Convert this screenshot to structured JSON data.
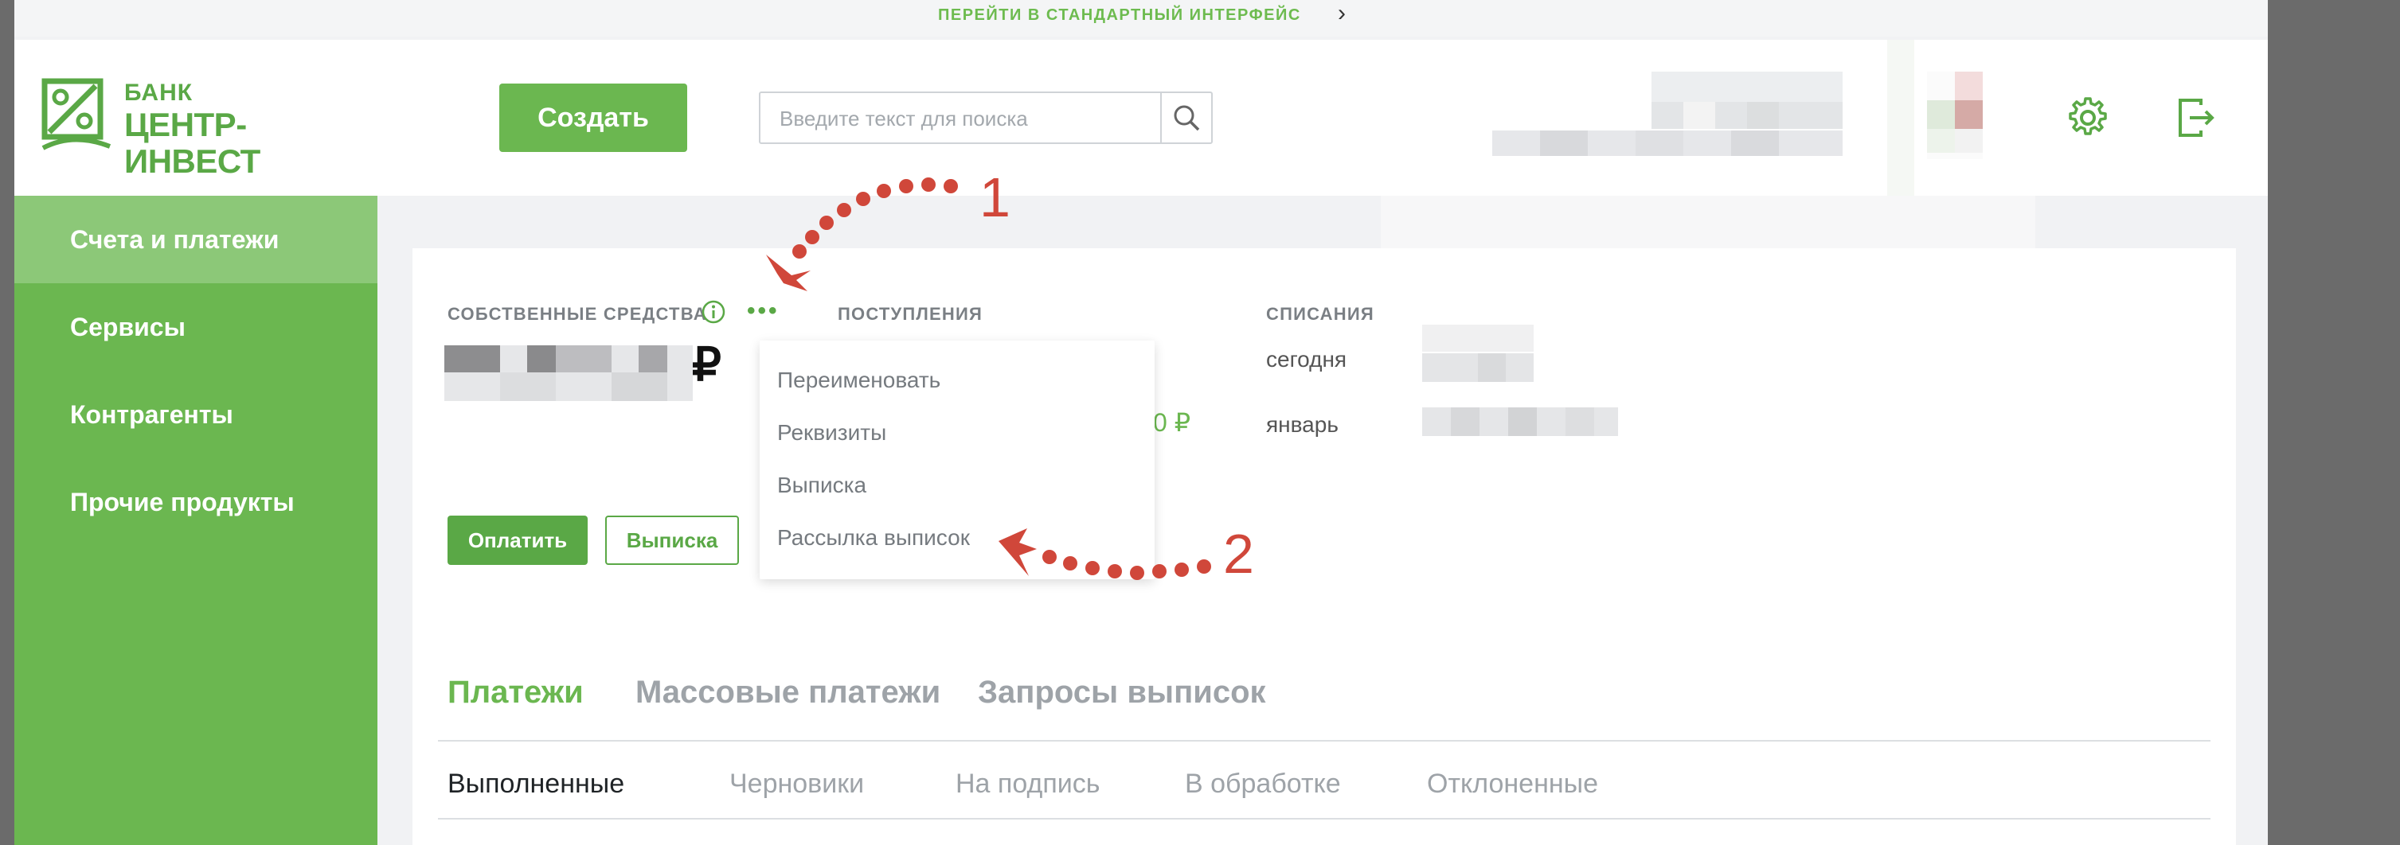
{
  "top_link": {
    "label": "ПЕРЕЙТИ В СТАНДАРТНЫЙ ИНТЕРФЕЙС"
  },
  "header": {
    "logo_line1": "БАНК",
    "logo_line2": "ЦЕНТР-ИНВЕСТ",
    "create_label": "Создать",
    "search_placeholder": "Введите текст для поиска"
  },
  "sidebar": {
    "items": [
      {
        "label": "Счета и платежи",
        "active": true
      },
      {
        "label": "Сервисы"
      },
      {
        "label": "Контрагенты"
      },
      {
        "label": "Прочие продукты"
      }
    ]
  },
  "account": {
    "own_funds_label": "СОБСТВЕННЫЕ СРЕДСТВА",
    "more_dots": "•••",
    "income_label": "ПОСТУПЛЕНИЯ",
    "debit_label": "СПИСАНИЯ",
    "currency": "₽",
    "today_label": "сегодня",
    "month_label": "январь",
    "income_value": "0 ₽",
    "pay_label": "Оплатить",
    "statement_label": "Выписка"
  },
  "menu": {
    "items": [
      "Переименовать",
      "Реквизиты",
      "Выписка",
      "Рассылка выписок"
    ]
  },
  "tabs": [
    "Платежи",
    "Массовые платежи",
    "Запросы выписок"
  ],
  "subtabs": [
    "Выполненные",
    "Черновики",
    "На подпись",
    "В обработке",
    "Отклоненные"
  ],
  "annotations": {
    "one": "1",
    "two": "2"
  },
  "colors": {
    "brand_green": "#6bb750",
    "annotation_red": "#d0473a"
  }
}
